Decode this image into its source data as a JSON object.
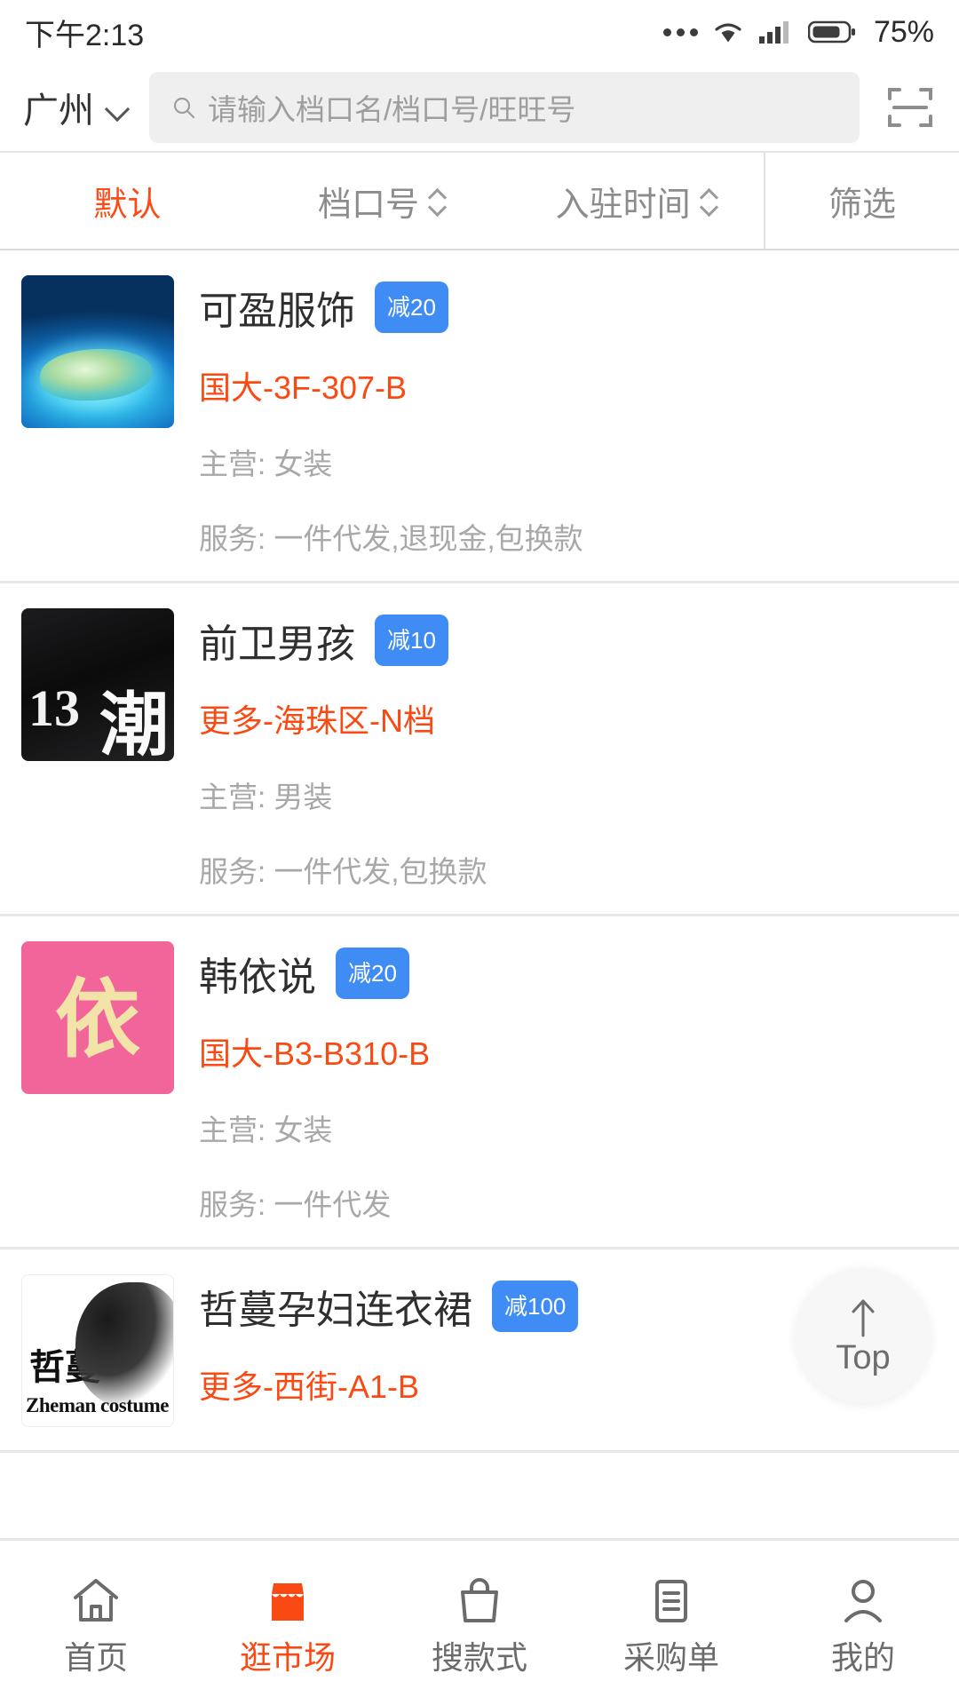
{
  "status_bar": {
    "time": "下午2:13",
    "battery_percent": "75%",
    "icons": [
      "more-dots-icon",
      "wifi-icon",
      "cellular-signal-icon",
      "battery-icon"
    ]
  },
  "header": {
    "city": "广州",
    "city_chevron_icon": "chevron-down-icon",
    "search_icon": "search-icon",
    "search_placeholder": "请输入档口名/档口号/旺旺号",
    "search_value": "",
    "scan_icon": "scan-qr-icon"
  },
  "filter_bar": {
    "items": [
      {
        "label": "默认",
        "active": true,
        "sortable": false
      },
      {
        "label": "档口号",
        "active": false,
        "sortable": true
      },
      {
        "label": "入驻时间",
        "active": false,
        "sortable": true
      },
      {
        "label": "筛选",
        "active": false,
        "sortable": false
      }
    ]
  },
  "shops": [
    {
      "name": "可盈服饰",
      "badge": "减20",
      "stall": "国大-3F-307-B",
      "main": "主营: 女装",
      "service": "服务: 一件代发,退现金,包换款",
      "thumb": "aerial-island-photo"
    },
    {
      "name": "前卫男孩",
      "badge": "减10",
      "stall": "更多-海珠区-N档",
      "main": "主营: 男装",
      "service": "服务: 一件代发,包换款",
      "thumb": "streetwear-men-photo"
    },
    {
      "name": "韩依说",
      "badge": "减20",
      "stall": "国大-B3-B310-B",
      "main": "主营: 女装",
      "service": "服务: 一件代发",
      "thumb": "pink-logo-image"
    },
    {
      "name": "哲蔓孕妇连衣裙",
      "badge": "减100",
      "stall": "更多-西街-A1-B",
      "main": "",
      "service": "",
      "thumb": "zheman-costume-logo"
    }
  ],
  "top_button": {
    "label": "Top",
    "icon": "arrow-up-icon"
  },
  "tabbar": {
    "items": [
      {
        "label": "首页",
        "icon": "home-icon",
        "active": false
      },
      {
        "label": "逛市场",
        "icon": "shop-icon",
        "active": true
      },
      {
        "label": "搜款式",
        "icon": "handbag-icon",
        "active": false
      },
      {
        "label": "采购单",
        "icon": "clipboard-icon",
        "active": false
      },
      {
        "label": "我的",
        "icon": "person-icon",
        "active": false
      }
    ]
  },
  "colors": {
    "accent_orange": "#fa4a14",
    "badge_blue": "#3f8cf4",
    "muted_gray": "#a8a8a8",
    "search_bg": "#efefef"
  }
}
